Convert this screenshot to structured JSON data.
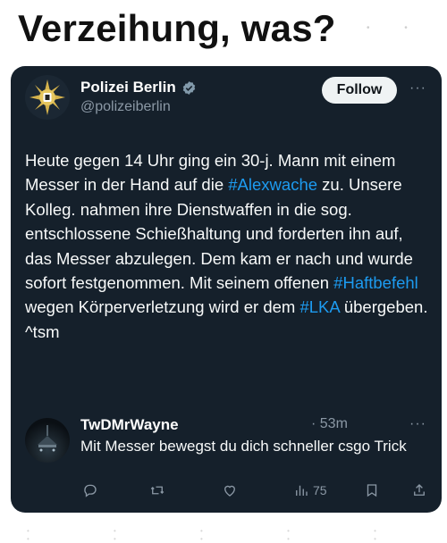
{
  "meme": {
    "title": "Verzeihung, was?"
  },
  "tweet": {
    "author_name": "Polizei Berlin",
    "author_handle": "@polizeiberlin",
    "follow_label": "Follow",
    "more": "···",
    "segments": [
      {
        "type": "text",
        "text": "Heute gegen 14 Uhr ging ein 30-j. Mann mit einem Messer in der Hand auf die "
      },
      {
        "type": "hashtag",
        "text": "#Alexwache"
      },
      {
        "type": "text",
        "text": " zu. Unsere Kolleg. nahmen ihre Dienstwaffen in die sog. entschlossene Schießhaltung und forderten ihn auf, das Messer abzulegen. Dem kam er nach und  wurde sofort festgenommen. Mit seinem offenen "
      },
      {
        "type": "hashtag",
        "text": "#Haftbefehl"
      },
      {
        "type": "text",
        "text": " wegen Körperverletzung wird er dem "
      },
      {
        "type": "hashtag",
        "text": "#LKA"
      },
      {
        "type": "text",
        "text": " übergeben. ^tsm"
      }
    ]
  },
  "reply": {
    "author_name": "TwDMrWayne",
    "time": "· 53m",
    "more": "···",
    "text": "Mit Messer bewegst du dich schneller csgo Trick"
  },
  "actions": {
    "views_count": "75"
  },
  "colors": {
    "card_bg": "#15202b",
    "link": "#1d9bf0",
    "muted": "#8b98a5"
  },
  "icons": [
    "verified-badge-icon",
    "police-star-icon",
    "reply-icon",
    "repost-icon",
    "like-icon",
    "views-icon",
    "bookmark-icon",
    "share-icon"
  ]
}
